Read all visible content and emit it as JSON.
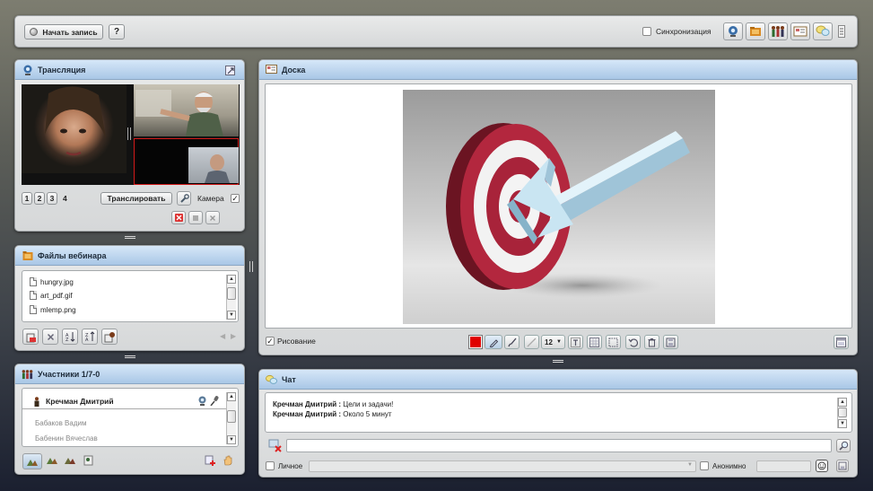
{
  "topbar": {
    "record_label": "Начать запись",
    "help_label": "?",
    "sync_label": "Синхронизация",
    "sync_checked": false,
    "module_icons": [
      "webcam-icon",
      "files-icon",
      "participants-icon",
      "board-icon",
      "chat-icon",
      "menu-icon"
    ]
  },
  "broadcast": {
    "title": "Трансляция",
    "pages": [
      "1",
      "2",
      "3",
      "4"
    ],
    "broadcast_button": "Транслировать",
    "camera_label": "Камера",
    "camera_checked": true
  },
  "files": {
    "title": "Файлы вебинара",
    "items": [
      "hungry.jpg",
      "art_pdf.gif",
      "mlemp.png"
    ]
  },
  "participants": {
    "title": "Участники 1/7-0",
    "host": "Кречман Дмитрий",
    "items": [
      "Бабаков Вадим",
      "Бабенин Вячеслав"
    ]
  },
  "board": {
    "title": "Доска",
    "drawing_label": "Рисование",
    "drawing_checked": true,
    "font_size": "12",
    "color": "#e00000"
  },
  "chat": {
    "title": "Чат",
    "messages": [
      {
        "author": "Кречман Дмитрий :",
        "text": "Цели и задачи!"
      },
      {
        "author": "Кречман Дмитрий :",
        "text": "Около 5 минут"
      }
    ],
    "private_label": "Личное",
    "anonymous_label": "Анонимно"
  },
  "colors": {
    "header_blue": "#a9c7e6",
    "target_red": "#a8233a",
    "arrow_blue": "#bfe0ee"
  }
}
